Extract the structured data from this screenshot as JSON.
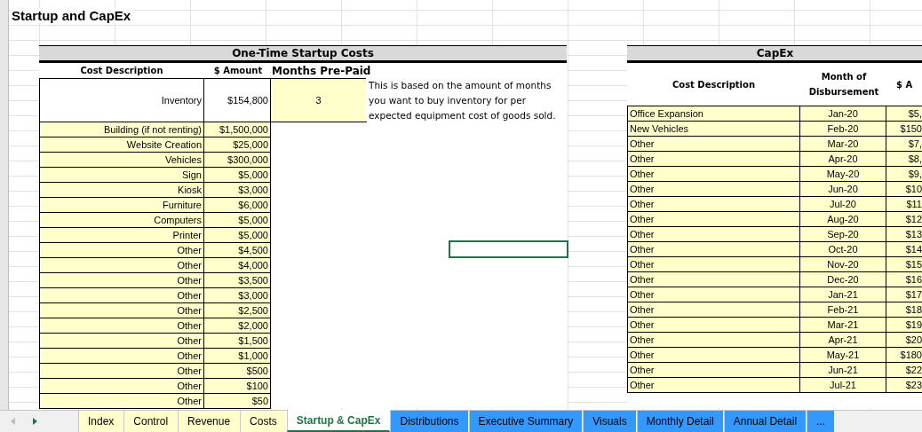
{
  "sheet_title": "Startup and CapEx",
  "startup": {
    "header": "One-Time Startup Costs",
    "columns": [
      "Cost Description",
      "$ Amount",
      "Months Pre-Paid"
    ],
    "inventory": {
      "description": "Inventory",
      "amount": "$154,800",
      "months": "3",
      "note": "This is based on the amount of months you want to buy inventory for per expected equipment cost of goods sold."
    },
    "rows": [
      {
        "description": "Building (if not renting)",
        "amount": "$1,500,000"
      },
      {
        "description": "Website Creation",
        "amount": "$25,000"
      },
      {
        "description": "Vehicles",
        "amount": "$300,000"
      },
      {
        "description": "Sign",
        "amount": "$5,000"
      },
      {
        "description": "Kiosk",
        "amount": "$3,000"
      },
      {
        "description": "Furniture",
        "amount": "$6,000"
      },
      {
        "description": "Computers",
        "amount": "$5,000"
      },
      {
        "description": "Printer",
        "amount": "$5,000"
      },
      {
        "description": "Other",
        "amount": "$4,500"
      },
      {
        "description": "Other",
        "amount": "$4,000"
      },
      {
        "description": "Other",
        "amount": "$3,500"
      },
      {
        "description": "Other",
        "amount": "$3,000"
      },
      {
        "description": "Other",
        "amount": "$2,500"
      },
      {
        "description": "Other",
        "amount": "$2,000"
      },
      {
        "description": "Other",
        "amount": "$1,500"
      },
      {
        "description": "Other",
        "amount": "$1,000"
      },
      {
        "description": "Other",
        "amount": "$500"
      },
      {
        "description": "Other",
        "amount": "$100"
      },
      {
        "description": "Other",
        "amount": "$50"
      }
    ]
  },
  "capex": {
    "header": "CapEx",
    "columns": [
      "Cost Description",
      "Month of Disbursement",
      "$ A"
    ],
    "rows": [
      {
        "description": "Office Expansion",
        "month": "Jan-20",
        "amount": "$5,"
      },
      {
        "description": "New Vehicles",
        "month": "Feb-20",
        "amount": "$150"
      },
      {
        "description": "Other",
        "month": "Mar-20",
        "amount": "$7,"
      },
      {
        "description": "Other",
        "month": "Apr-20",
        "amount": "$8,"
      },
      {
        "description": "Other",
        "month": "May-20",
        "amount": "$9,"
      },
      {
        "description": "Other",
        "month": "Jun-20",
        "amount": "$10"
      },
      {
        "description": "Other",
        "month": "Jul-20",
        "amount": "$11"
      },
      {
        "description": "Other",
        "month": "Aug-20",
        "amount": "$12"
      },
      {
        "description": "Other",
        "month": "Sep-20",
        "amount": "$13"
      },
      {
        "description": "Other",
        "month": "Oct-20",
        "amount": "$14"
      },
      {
        "description": "Other",
        "month": "Nov-20",
        "amount": "$15"
      },
      {
        "description": "Other",
        "month": "Dec-20",
        "amount": "$16"
      },
      {
        "description": "Other",
        "month": "Jan-21",
        "amount": "$17"
      },
      {
        "description": "Other",
        "month": "Feb-21",
        "amount": "$18"
      },
      {
        "description": "Other",
        "month": "Mar-21",
        "amount": "$19"
      },
      {
        "description": "Other",
        "month": "Apr-21",
        "amount": "$20"
      },
      {
        "description": "Other",
        "month": "May-21",
        "amount": "$180"
      },
      {
        "description": "Other",
        "month": "Jun-21",
        "amount": "$22"
      },
      {
        "description": "Other",
        "month": "Jul-21",
        "amount": "$23"
      }
    ]
  },
  "tabs": [
    {
      "label": "Index",
      "selected": false,
      "color": "#ffffcc"
    },
    {
      "label": "Control",
      "selected": false,
      "color": "#ffffcc"
    },
    {
      "label": "Revenue",
      "selected": false,
      "color": "#ffffcc"
    },
    {
      "label": "Costs",
      "selected": false,
      "color": "#ffffcc"
    },
    {
      "label": "Startup & CapEx",
      "selected": true,
      "color": "#ffffff"
    },
    {
      "label": "Distributions",
      "selected": false,
      "color": "#3399ff"
    },
    {
      "label": "Executive Summary",
      "selected": false,
      "color": "#3399ff"
    },
    {
      "label": "Visuals",
      "selected": false,
      "color": "#3399ff"
    },
    {
      "label": "Monthly Detail",
      "selected": false,
      "color": "#3399ff"
    },
    {
      "label": "Annual Detail",
      "selected": false,
      "color": "#3399ff"
    },
    {
      "label": "...",
      "selected": false,
      "color": "#3399ff"
    }
  ]
}
